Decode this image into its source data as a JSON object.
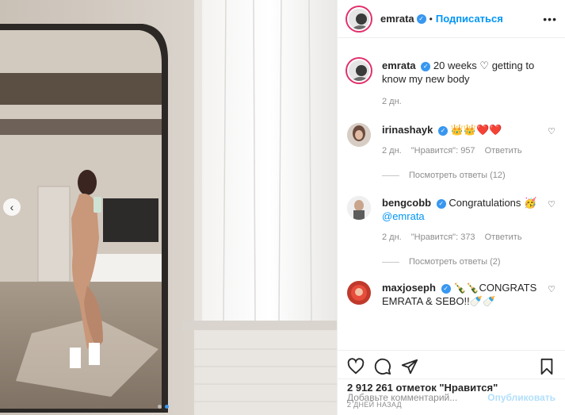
{
  "header": {
    "username": "emrata",
    "follow_label": "Подписаться",
    "more": "•••"
  },
  "caption": {
    "username": "emrata",
    "text": "20 weeks ♡ getting to know my new body",
    "time": "2 дн."
  },
  "comments": [
    {
      "username": "irinashayk",
      "text": "👑👑❤️❤️",
      "time": "2 дн.",
      "likes": "\"Нравится\": 957",
      "reply": "Ответить",
      "view_replies": "Посмотреть ответы (12)"
    },
    {
      "username": "bengcobb",
      "text": "Congratulations 🥳",
      "mention": "@emrata",
      "time": "2 дн.",
      "likes": "\"Нравится\": 373",
      "reply": "Ответить",
      "view_replies": "Посмотреть ответы (2)"
    },
    {
      "username": "maxjoseph",
      "text": "🍾🍾CONGRATS EMRATA & SEBO!!🍼🍼"
    }
  ],
  "likes_count": "2 912 261 отметок \"Нравится\"",
  "post_age": "2 ДНЕЙ НАЗАД",
  "composer": {
    "placeholder": "Добавьте комментарий...",
    "post_label": "Опубликовать"
  },
  "icons": {
    "verified": "verified-badge-icon",
    "heart": "heart-icon",
    "comment": "comment-icon",
    "share": "share-icon",
    "save": "bookmark-icon",
    "prev": "chevron-left-icon"
  },
  "colors": {
    "link": "#0095f6",
    "story_ring": "#e1306c",
    "muted": "#8e8e8e",
    "heart_red": "#ed4956",
    "carousel_dot": "#3897f0"
  }
}
